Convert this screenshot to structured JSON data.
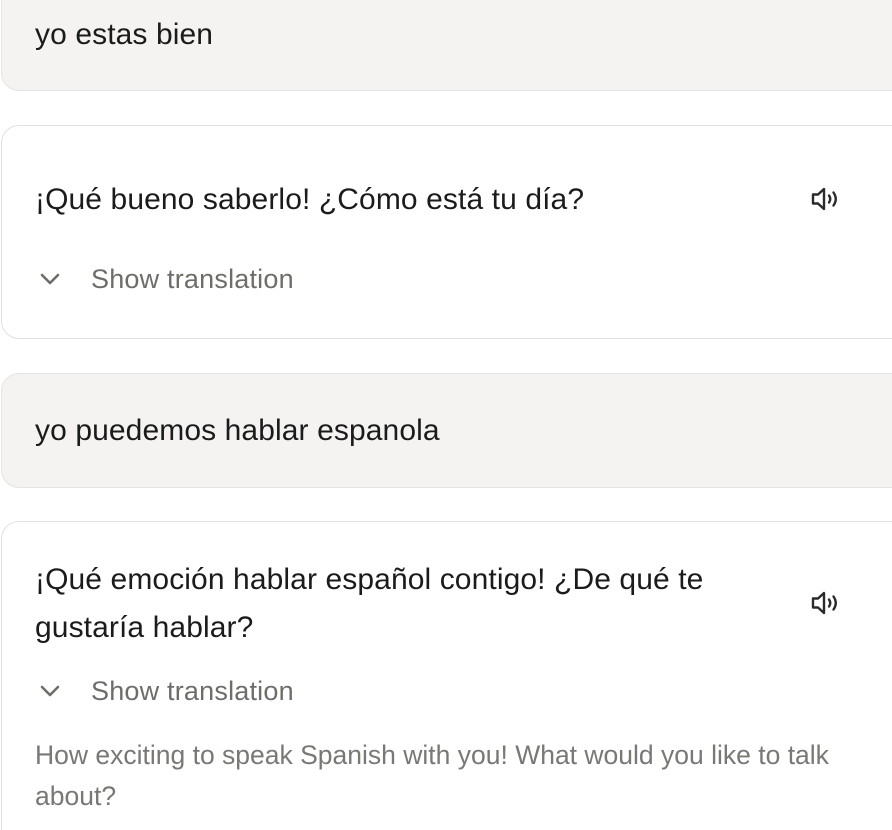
{
  "conversation": {
    "messages": [
      {
        "role": "user",
        "text": "yo estas bien"
      },
      {
        "role": "assistant",
        "text": "¡Qué bueno saberlo! ¿Cómo está tu día?",
        "toggle_label": "Show translation",
        "speaker_icon": "speaker-icon"
      },
      {
        "role": "user",
        "text": "yo puedemos hablar espanola"
      },
      {
        "role": "assistant",
        "text": "¡Qué emoción hablar español contigo! ¿De qué te gustaría hablar?",
        "toggle_label": "Show translation",
        "translation": "How exciting to speak Spanish with you! What would you like to talk about?",
        "speaker_icon": "speaker-icon"
      }
    ]
  },
  "colors": {
    "user_bubble_bg": "#f4f3f2",
    "assistant_bubble_bg": "#ffffff",
    "border": "#e3e1de",
    "muted_text": "#6f6d6a"
  }
}
